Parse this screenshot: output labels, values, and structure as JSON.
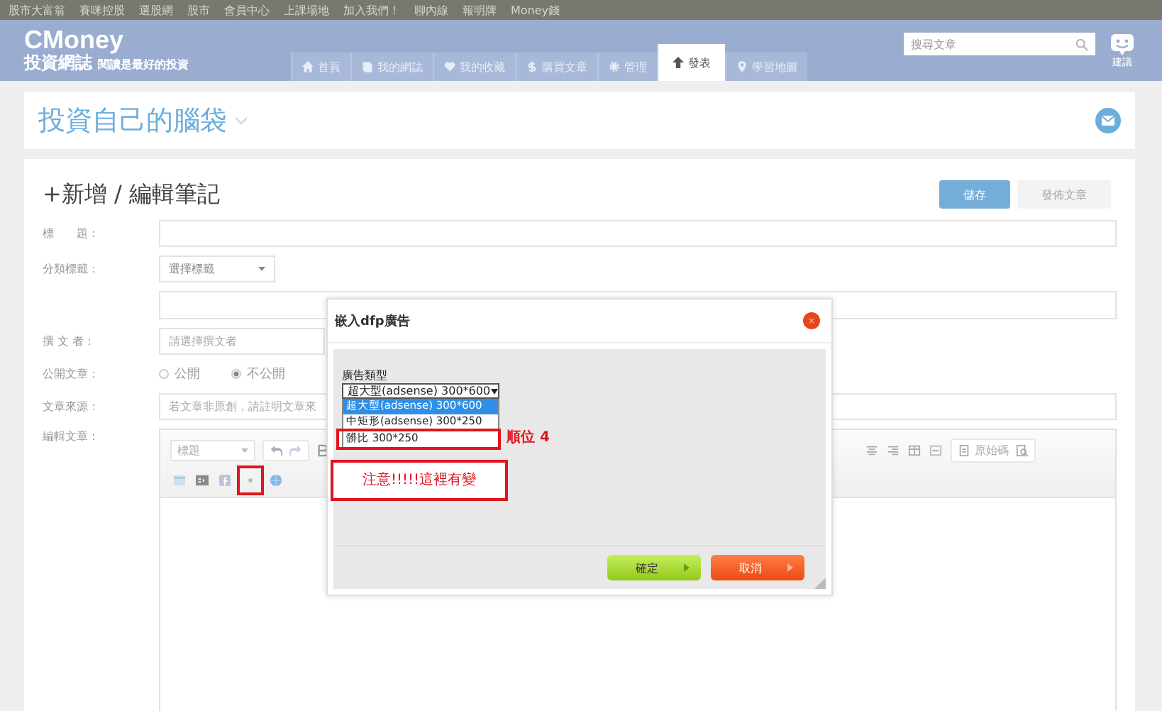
{
  "top_links": [
    "股市大富翁",
    "賽咪控股",
    "選股網",
    "股市",
    "會員中心",
    "上課場地",
    "加入我們！",
    "聊內線",
    "報明牌",
    "Money錢"
  ],
  "header": {
    "logo": "CMoney",
    "site_name": "投資網誌",
    "slogan": "閱讀是最好的投資",
    "nav": [
      {
        "label": "首頁",
        "selected": false
      },
      {
        "label": "我的網誌",
        "selected": false
      },
      {
        "label": "我的收藏",
        "selected": false
      },
      {
        "label": "購買文章",
        "selected": false
      },
      {
        "label": "管理",
        "selected": false
      },
      {
        "label": "發表",
        "selected": true
      },
      {
        "label": "學習地圖",
        "selected": false
      }
    ],
    "search": {
      "placeholder": "搜尋文章"
    },
    "feedback": "建議"
  },
  "blog": {
    "title": "投資自己的腦袋"
  },
  "editor": {
    "heading": "+新增 / 編輯筆記",
    "buttons": [
      {
        "label": "儲存",
        "disabled": false
      },
      {
        "label": "發佈文章",
        "disabled": true
      }
    ],
    "fields": [
      {
        "kind": "text",
        "label": "標　　題："
      },
      {
        "kind": "select",
        "label": "分類標籤：",
        "value": "選擇標籤"
      },
      {
        "kind": "text"
      },
      {
        "kind": "short",
        "label": "撰 文 者：",
        "placeholder": "請選擇撰文者"
      },
      {
        "kind": "radio",
        "label": "公開文章：",
        "options": [
          {
            "label": "公開",
            "selected": false
          },
          {
            "label": "不公開",
            "selected": true
          }
        ]
      },
      {
        "kind": "text",
        "label": "文章來源：",
        "placeholder": "若文章非原創，請註明文章來"
      },
      {
        "kind": "editor",
        "label": "編輯文章：",
        "format": "標題",
        "source_button": "原始碼"
      }
    ]
  },
  "dialog": {
    "title": "嵌入dfp廣告",
    "field_label": "廣告類型",
    "select_value": "超大型(adsense) 300*600",
    "options": [
      {
        "label": "超大型(adsense) 300*600",
        "selected": true
      },
      {
        "label": "中矩形(adsense) 300*250",
        "selected": false
      },
      {
        "label": "髒比 300*250",
        "selected": false
      }
    ],
    "buttons": [
      {
        "label": "確定",
        "kind": "confirm"
      },
      {
        "label": "取消",
        "kind": "cancel"
      }
    ]
  },
  "annotations": [
    {
      "kind": "option_box",
      "note": "順位 4"
    },
    {
      "kind": "callout",
      "text": "注意!!!!!這裡有變"
    },
    {
      "kind": "icon_box"
    }
  ]
}
